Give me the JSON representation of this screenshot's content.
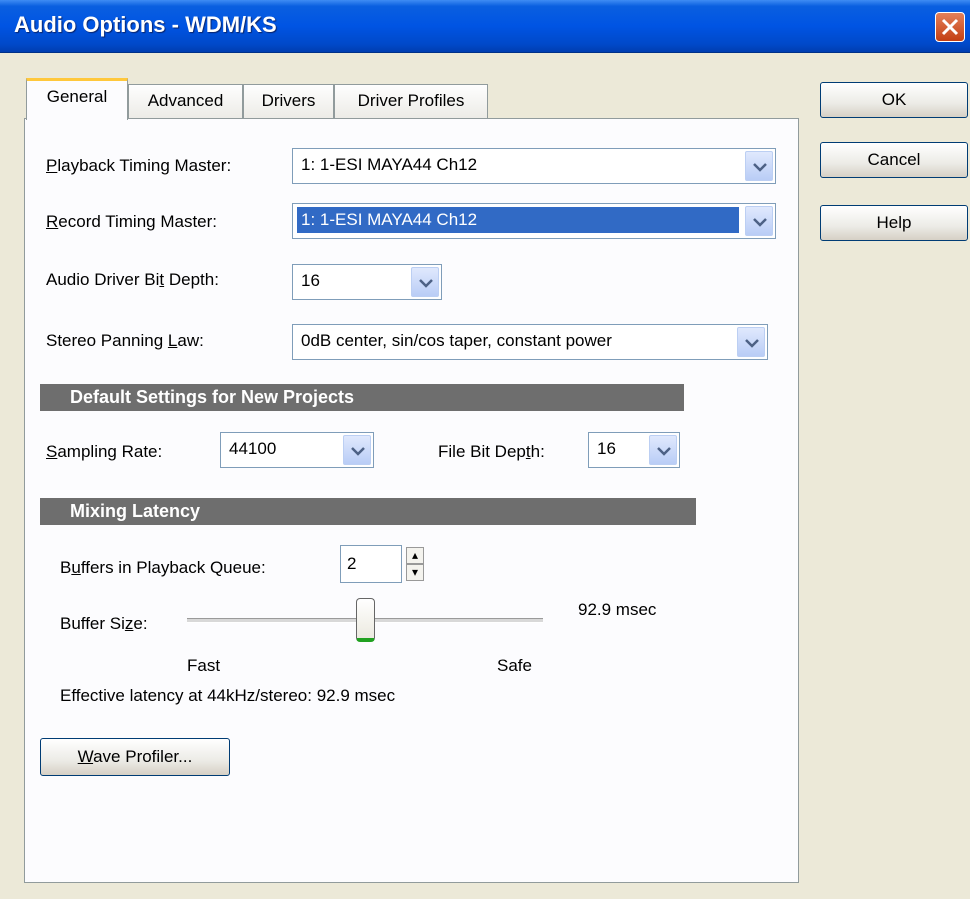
{
  "window": {
    "title": "Audio Options - WDM/KS"
  },
  "tabs": [
    {
      "label": "General"
    },
    {
      "label": "Advanced"
    },
    {
      "label": "Drivers"
    },
    {
      "label": "Driver Profiles"
    }
  ],
  "buttons": {
    "ok": "OK",
    "cancel": "Cancel",
    "help": "Help"
  },
  "fields": {
    "playback_timing_master": {
      "label_pre": "",
      "label_u": "P",
      "label_post": "layback Timing Master:",
      "value": "1: 1-ESI MAYA44 Ch12"
    },
    "record_timing_master": {
      "label_pre": "",
      "label_u": "R",
      "label_post": "ecord Timing Master:",
      "value": "1: 1-ESI MAYA44 Ch12"
    },
    "audio_driver_bit_depth": {
      "label_pre": "Audio Driver Bi",
      "label_u": "t",
      "label_post": " Depth:",
      "value": "16"
    },
    "stereo_panning_law": {
      "label_pre": "Stereo Panning ",
      "label_u": "L",
      "label_post": "aw:",
      "value": "0dB center, sin/cos taper, constant power"
    }
  },
  "default_settings": {
    "header": "Default Settings for New Projects",
    "sampling_rate": {
      "label_pre": "",
      "label_u": "S",
      "label_post": "ampling Rate:",
      "value": "44100"
    },
    "file_bit_depth": {
      "label_pre": "File Bit Dep",
      "label_u": "t",
      "label_post": "h:",
      "value": "16"
    }
  },
  "mixing_latency": {
    "header": "Mixing Latency",
    "buffers_label_pre": "B",
    "buffers_label_u": "u",
    "buffers_label_post": "ffers in Playback Queue:",
    "buffers_value": "2",
    "buffer_size_label_pre": "Buffer Si",
    "buffer_size_label_u": "z",
    "buffer_size_label_post": "e:",
    "buffer_size_value": "92.9 msec",
    "slider_fraction": 0.5,
    "fast_label": "Fast",
    "safe_label": "Safe",
    "effective_latency": "Effective latency at 44kHz/stereo:  92.9 msec"
  },
  "wave_profiler": {
    "label_u": "W",
    "label_post": "ave Profiler..."
  },
  "icons": {
    "close": "close-icon",
    "dropdown": "chevron-down-icon",
    "spin_up": "spin-up-icon",
    "spin_down": "spin-down-icon"
  },
  "colors": {
    "title_bar": "#0054e3",
    "selection": "#316ac5",
    "section_header": "#6e6e6e",
    "close_button": "#c33f13"
  }
}
